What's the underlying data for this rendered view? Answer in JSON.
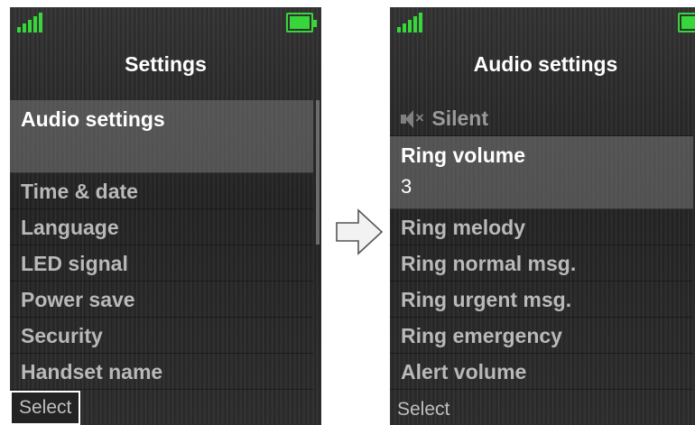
{
  "left_screen": {
    "title": "Settings",
    "items": [
      {
        "label": "Audio settings"
      },
      {
        "label": "Time & date"
      },
      {
        "label": "Language"
      },
      {
        "label": "LED signal"
      },
      {
        "label": "Power save"
      },
      {
        "label": "Security"
      },
      {
        "label": "Handset name"
      }
    ],
    "softkey": "Select"
  },
  "right_screen": {
    "title": "Audio settings",
    "items": [
      {
        "label": "Silent",
        "icon": "speaker-muted-icon"
      },
      {
        "label": "Ring volume",
        "value": "3"
      },
      {
        "label": "Ring melody"
      },
      {
        "label": "Ring normal msg."
      },
      {
        "label": "Ring urgent msg."
      },
      {
        "label": "Ring emergency"
      },
      {
        "label": "Alert volume"
      }
    ],
    "softkey": "Select"
  },
  "colors": {
    "signal": "#37d63a",
    "battery": "#37d63a",
    "selected_text": "#ffffff",
    "item_text": "#b9b9b9"
  },
  "transition_icon": "right-arrow-icon"
}
